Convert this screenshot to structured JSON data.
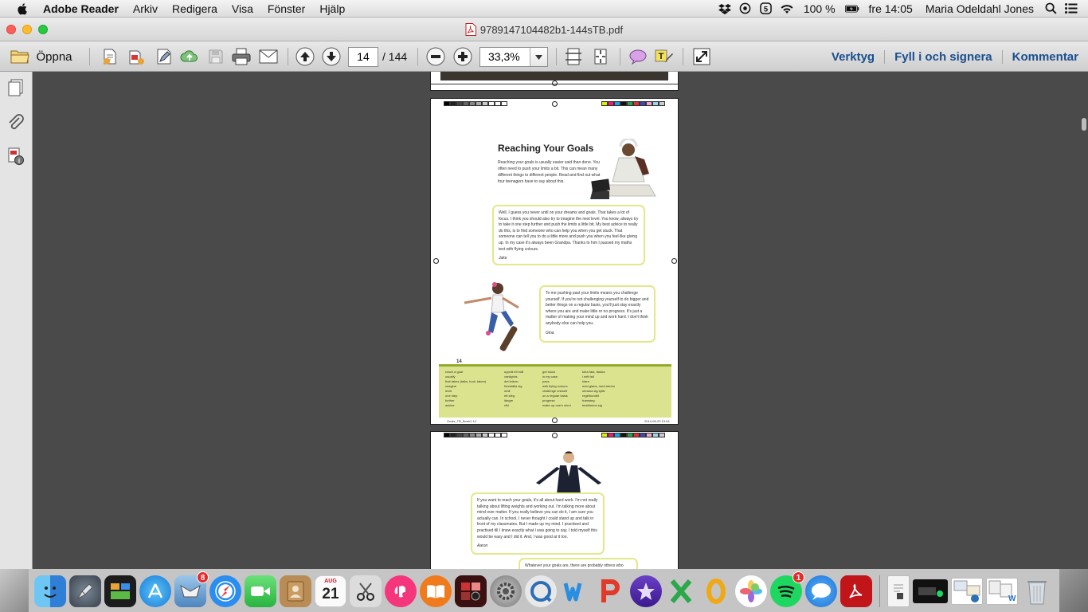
{
  "menubar": {
    "app_name": "Adobe Reader",
    "menus": [
      "Arkiv",
      "Redigera",
      "Visa",
      "Fönster",
      "Hjälp"
    ],
    "battery": "100 %",
    "clock": "fre 14:05",
    "user": "Maria Odeldahl Jones"
  },
  "window": {
    "title": "9789147104482b1-144sTB.pdf"
  },
  "toolbar": {
    "open_label": "Öppna",
    "page_current": "14",
    "page_total": "/ 144",
    "zoom": "33,3%",
    "tools_label": "Verktyg",
    "fill_sign_label": "Fyll i och signera",
    "comment_label": "Kommentar"
  },
  "page": {
    "title": "Reaching Your Goals",
    "intro": "Reaching your goals is usually easier said than done. You often need to push your limits a bit. This can mean many different things to different people. Read and find out what four teenagers have to say about this.",
    "jake_text": "Well, I guess you never until on your dreams and goals. That takes a lot of focus. I think you should also try to imagine the next level. You know, always try to take it one step further and push the limits a little bit. My best advice to really do this, is to find someone who can help you when you get stuck. That someone can tell you to do a little more and push you when you feel like giving up. In my case it's always been Grandpa. Thanks to him I passed my maths test with flying colours.",
    "jake_name": "Jake",
    "gina_text": "To me pushing past your limits means you challenge yourself. If you're not challenging yourself to do bigger and better things on a regular basis, you'll just stay exactly where you are and make little or no progress. It's just a matter of making your mind up and work hard. I don't think anybody else can help you.",
    "gina_name": "Gina",
    "page_number": "14",
    "vocab": [
      [
        "reach a goal",
        "usually",
        "that takes (talks, took, taken)",
        "imagine",
        "level",
        "one step",
        "further",
        "advice"
      ],
      [
        "uppnå ett mål",
        "vanligtvis",
        "det kräver",
        "föreställa sig",
        "nivå",
        "ett steg",
        "längre",
        "råd"
      ],
      [
        "get stuck",
        "in my case",
        "pass",
        "with flying colours",
        "challenge oneself",
        "on a regular basis",
        "progress",
        "make up one's mind"
      ],
      [
        "köra fast, fastna",
        "i mitt fall",
        "klara",
        "med glans, med beröm",
        "utmana sig själv",
        "regelbundet",
        "framsteg",
        "bestämma sig"
      ]
    ],
    "footer_left": "Goals_TB_Book1 14",
    "footer_right": "2014-05-23 13:04"
  },
  "next_page": {
    "aaron_text": "If you want to reach your goals, it's all about hard work. I'm not really talking about lifting weights and working out. I'm talking more about mind over matter. If you really believe you can do it, I am sure you actually can. In school, I never thought I could stand up and talk in front of my classmates. But I made up my mind. I practised and practised till I knew exactly what I was going to say. I told myself this would be easy and I did it. And, I was good at it too.",
    "aaron_name": "Aaron",
    "next_text": "Whatever your goals are, there are probably others who"
  },
  "dock": {
    "calendar_month": "AUG",
    "calendar_day": "21",
    "mail_badge": "8",
    "spotify_badge": "1"
  }
}
